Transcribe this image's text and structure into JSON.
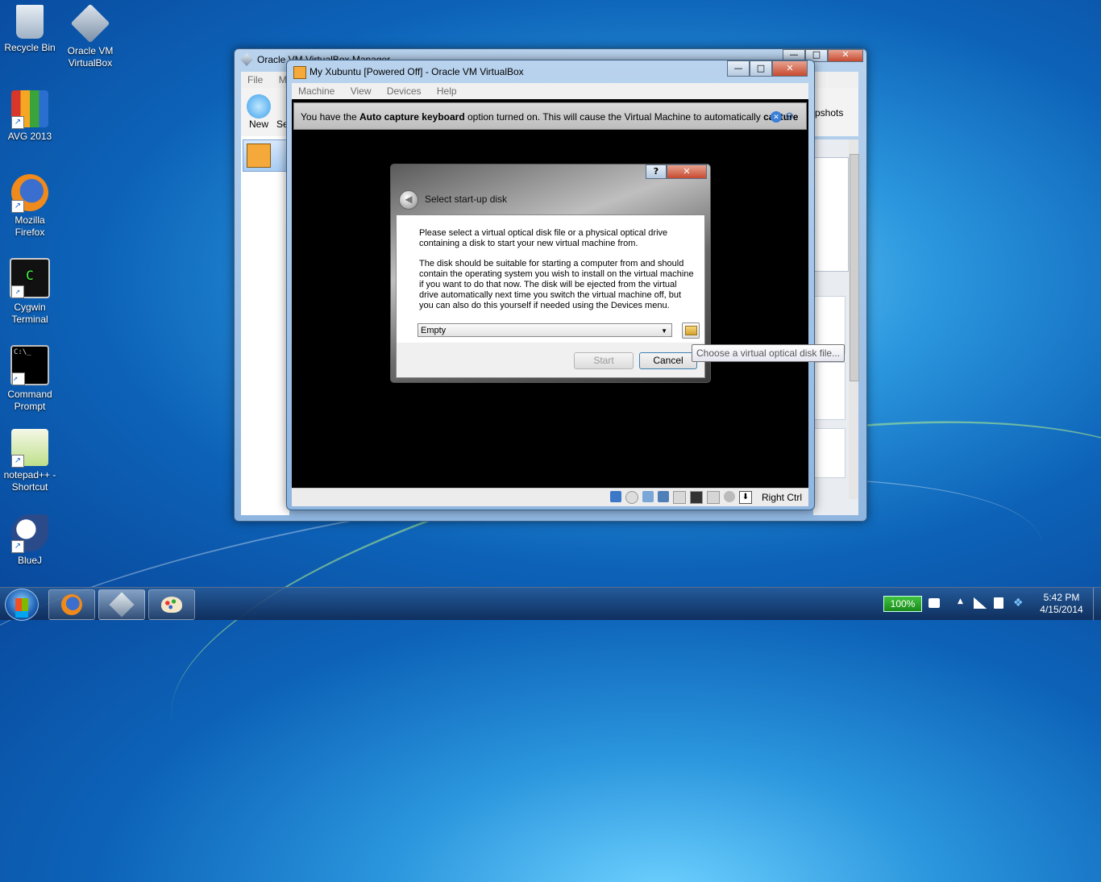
{
  "desktop": {
    "icons": [
      {
        "label": "Recycle Bin"
      },
      {
        "label": "Oracle VM VirtualBox"
      },
      {
        "label": "AVG 2013"
      },
      {
        "label": "Mozilla Firefox"
      },
      {
        "label": "Cygwin Terminal"
      },
      {
        "label": "Command Prompt"
      },
      {
        "label": "notepad++ - Shortcut"
      },
      {
        "label": "BlueJ"
      }
    ]
  },
  "manager": {
    "title": "Oracle VM VirtualBox Manager",
    "menu": [
      "File",
      "Ma"
    ],
    "toolbar": {
      "new_label": "New",
      "settings_label": "Se",
      "snapshots_label": "pshots"
    }
  },
  "vm_window": {
    "title": "My Xubuntu [Powered Off] - Oracle VM VirtualBox",
    "menu": [
      "Machine",
      "View",
      "Devices",
      "Help"
    ],
    "notice": {
      "prefix": "You have the ",
      "bold1": "Auto capture keyboard",
      "middle": " option turned on. This will cause the Virtual Machine to automatically ",
      "bold2": "capture"
    },
    "status": {
      "host_key": "Right Ctrl"
    }
  },
  "dialog": {
    "title": "Select start-up disk",
    "help_button": "?",
    "close_button": "✕",
    "para1": "Please select a virtual optical disk file or a physical optical drive containing a disk to start your new virtual machine from.",
    "para2": "The disk should be suitable for starting a computer from and should contain the operating system you wish to install on the virtual machine if you want to do that now. The disk will be ejected from the virtual drive automatically next time you switch the virtual machine off, but you can also do this yourself if needed using the Devices menu.",
    "disk_select": "Empty",
    "start_button": "Start",
    "cancel_button": "Cancel",
    "tooltip": "Choose a virtual optical disk file..."
  },
  "taskbar": {
    "battery": "100%",
    "time": "5:42 PM",
    "date": "4/15/2014"
  }
}
